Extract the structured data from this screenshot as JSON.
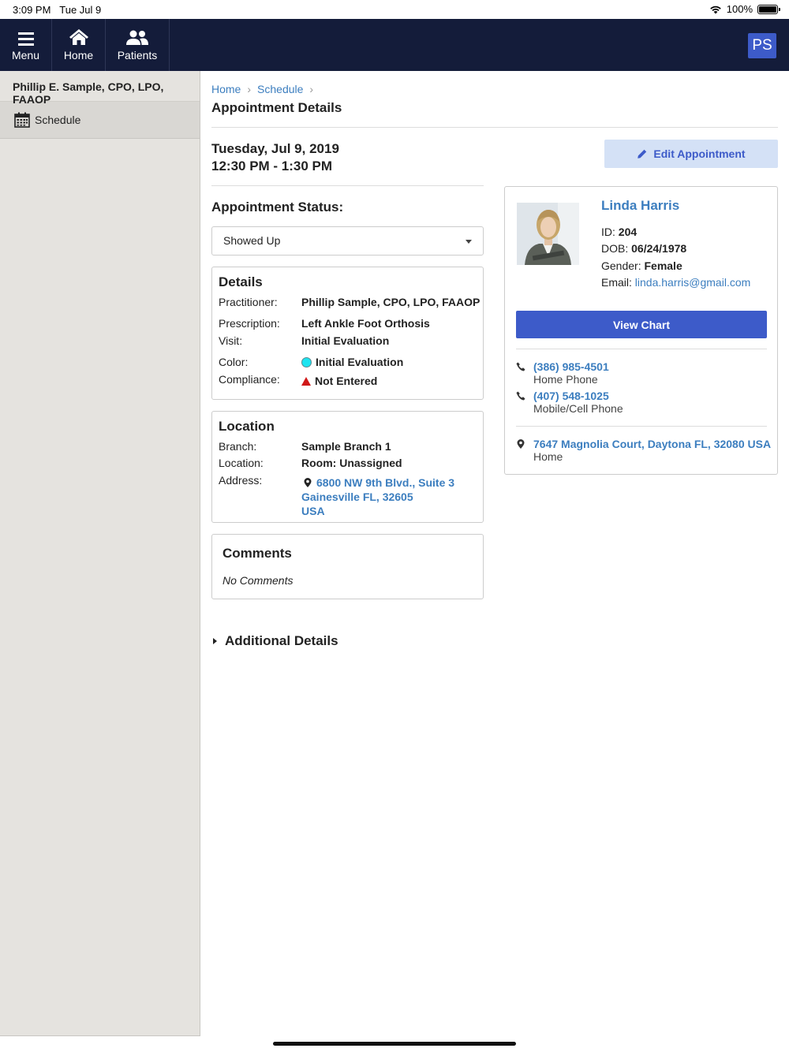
{
  "status_bar": {
    "time": "3:09 PM",
    "date": "Tue Jul 9",
    "battery": "100%",
    "battery_level": 1.0
  },
  "nav": {
    "menu": "Menu",
    "home": "Home",
    "patients": "Patients",
    "user_initials": "PS"
  },
  "sidebar": {
    "user": "Phillip E. Sample, CPO, LPO, FAAOP",
    "items": [
      {
        "label": "Schedule",
        "icon": "calendar-icon"
      }
    ]
  },
  "breadcrumb": {
    "home": "Home",
    "schedule": "Schedule"
  },
  "page_title": "Appointment Details",
  "appointment": {
    "date": "Tuesday, Jul 9, 2019",
    "time": "12:30 PM - 1:30 PM",
    "edit_label": "Edit Appointment",
    "status_label": "Appointment Status:",
    "status_value": "Showed Up"
  },
  "details": {
    "title": "Details",
    "practitioner_label": "Practitioner:",
    "practitioner": "Phillip Sample, CPO, LPO, FAAOP",
    "prescription_label": "Prescription:",
    "prescription": "Left Ankle Foot Orthosis",
    "visit_label": "Visit:",
    "visit": "Initial Evaluation",
    "color_label": "Color:",
    "color": "Initial Evaluation",
    "color_hex": "#1de4f0",
    "compliance_label": "Compliance:",
    "compliance": "Not Entered",
    "compliance_color": "#d01818"
  },
  "location": {
    "title": "Location",
    "branch_label": "Branch:",
    "branch": "Sample Branch 1",
    "location_label": "Location:",
    "location": "Room: Unassigned",
    "address_label": "Address:",
    "address_line1": "6800 NW 9th Blvd., Suite 3",
    "address_line2": "Gainesville FL, 32605",
    "address_line3": "USA"
  },
  "comments": {
    "title": "Comments",
    "text": "No Comments"
  },
  "additional_details": "Additional Details",
  "patient": {
    "name": "Linda Harris",
    "id_label": "ID:",
    "id": "204",
    "dob_label": "DOB:",
    "dob": "06/24/1978",
    "gender_label": "Gender:",
    "gender": "Female",
    "email_label": "Email:",
    "email": "linda.harris@gmail.com",
    "view_chart": "View Chart",
    "phones": [
      {
        "number": "(386) 985-4501",
        "type": "Home Phone"
      },
      {
        "number": "(407) 548-1025",
        "type": "Mobile/Cell Phone"
      }
    ],
    "address": {
      "text": "7647 Magnolia Court, Daytona FL, 32080 USA",
      "type": "Home"
    }
  },
  "colors": {
    "nav_bg": "#141c3a",
    "accent": "#3d5bc9",
    "link": "#3c7ebf",
    "sidebar_bg": "#e5e3df"
  }
}
